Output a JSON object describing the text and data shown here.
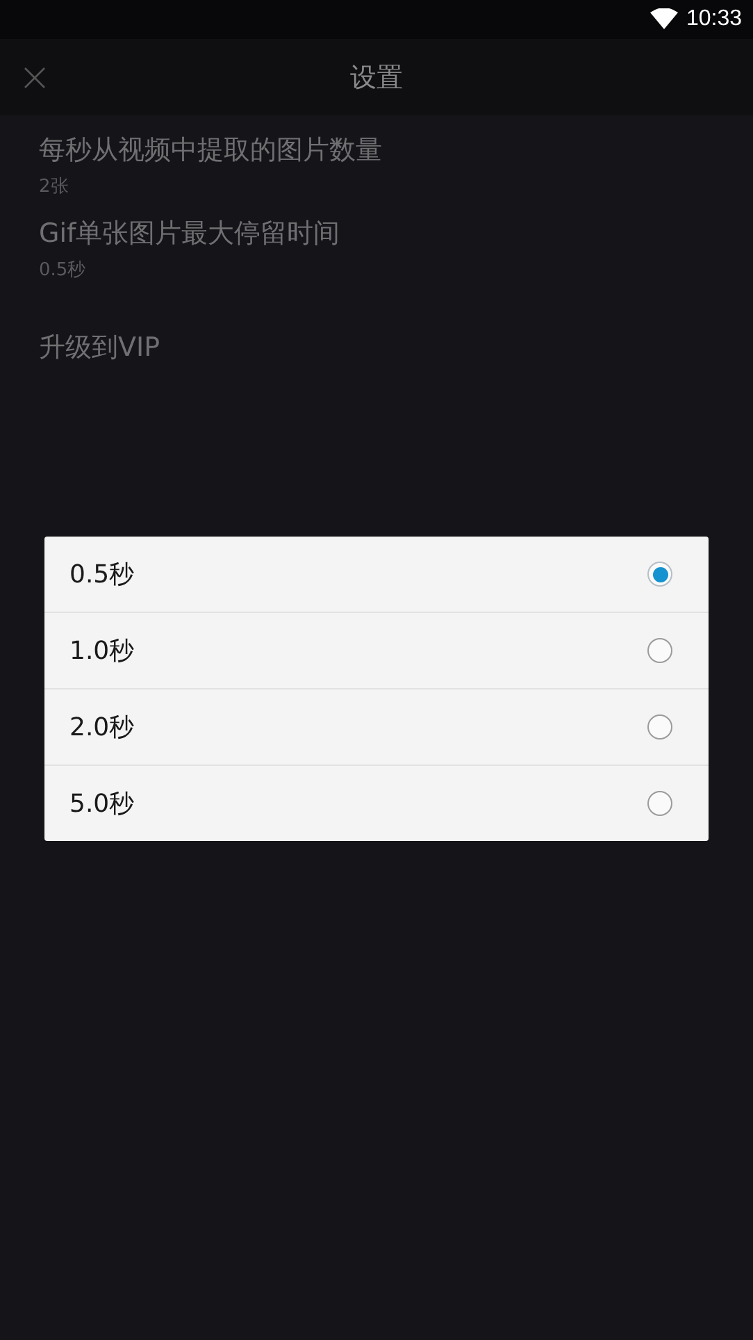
{
  "status_bar": {
    "time": "10:33"
  },
  "app_bar": {
    "title": "设置"
  },
  "settings": [
    {
      "title": "每秒从视频中提取的图片数量",
      "value": "2张"
    },
    {
      "title": "Gif单张图片最大停留时间",
      "value": "0.5秒"
    },
    {
      "title": "升级到VIP"
    }
  ],
  "dialog": {
    "options": [
      {
        "label": "0.5秒",
        "selected": true
      },
      {
        "label": "1.0秒",
        "selected": false
      },
      {
        "label": "2.0秒",
        "selected": false
      },
      {
        "label": "5.0秒",
        "selected": false
      }
    ]
  }
}
